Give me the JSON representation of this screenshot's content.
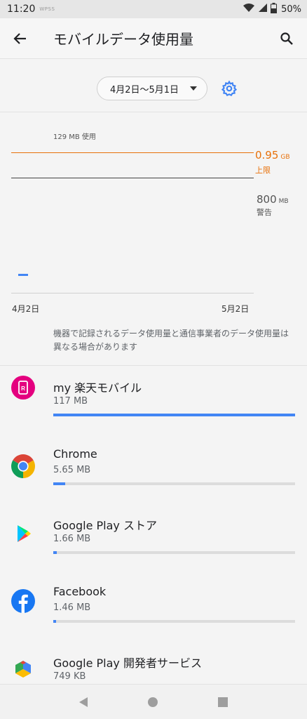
{
  "status_bar": {
    "time": "11:20",
    "carrier": "WPSS",
    "battery": "50%"
  },
  "header": {
    "title": "モバイルデータ使用量"
  },
  "cycle": {
    "label": "4月2日～5月1日"
  },
  "chart": {
    "usage_label": "129 MB 使用",
    "limit_value": "0.95",
    "limit_unit": "GB",
    "limit_label": "上限",
    "warning_value": "800",
    "warning_unit": "MB",
    "warning_label": "警告",
    "x_start": "4月2日",
    "x_end": "5月2日"
  },
  "note": "機器で記録されるデータ使用量と通信事業者のデータ使用量は異なる場合があります",
  "apps": [
    {
      "name": "my 楽天モバイル",
      "size": "117 MB",
      "fraction": 1.0,
      "icon": "rakuten-icon"
    },
    {
      "name": "Chrome",
      "size": "5.65 MB",
      "fraction": 0.048,
      "icon": "chrome-icon"
    },
    {
      "name": "Google Play ストア",
      "size": "1.66 MB",
      "fraction": 0.014,
      "icon": "play-store-icon"
    },
    {
      "name": "Facebook",
      "size": "1.46 MB",
      "fraction": 0.012,
      "icon": "facebook-icon"
    },
    {
      "name": "Google Play 開発者サービス",
      "size": "749 KB",
      "fraction": 0.006,
      "icon": "play-services-icon"
    }
  ],
  "colors": {
    "accent": "#4285f4",
    "limit": "#e8710a",
    "rakuten": "#e4007f",
    "facebook": "#1877f2"
  }
}
